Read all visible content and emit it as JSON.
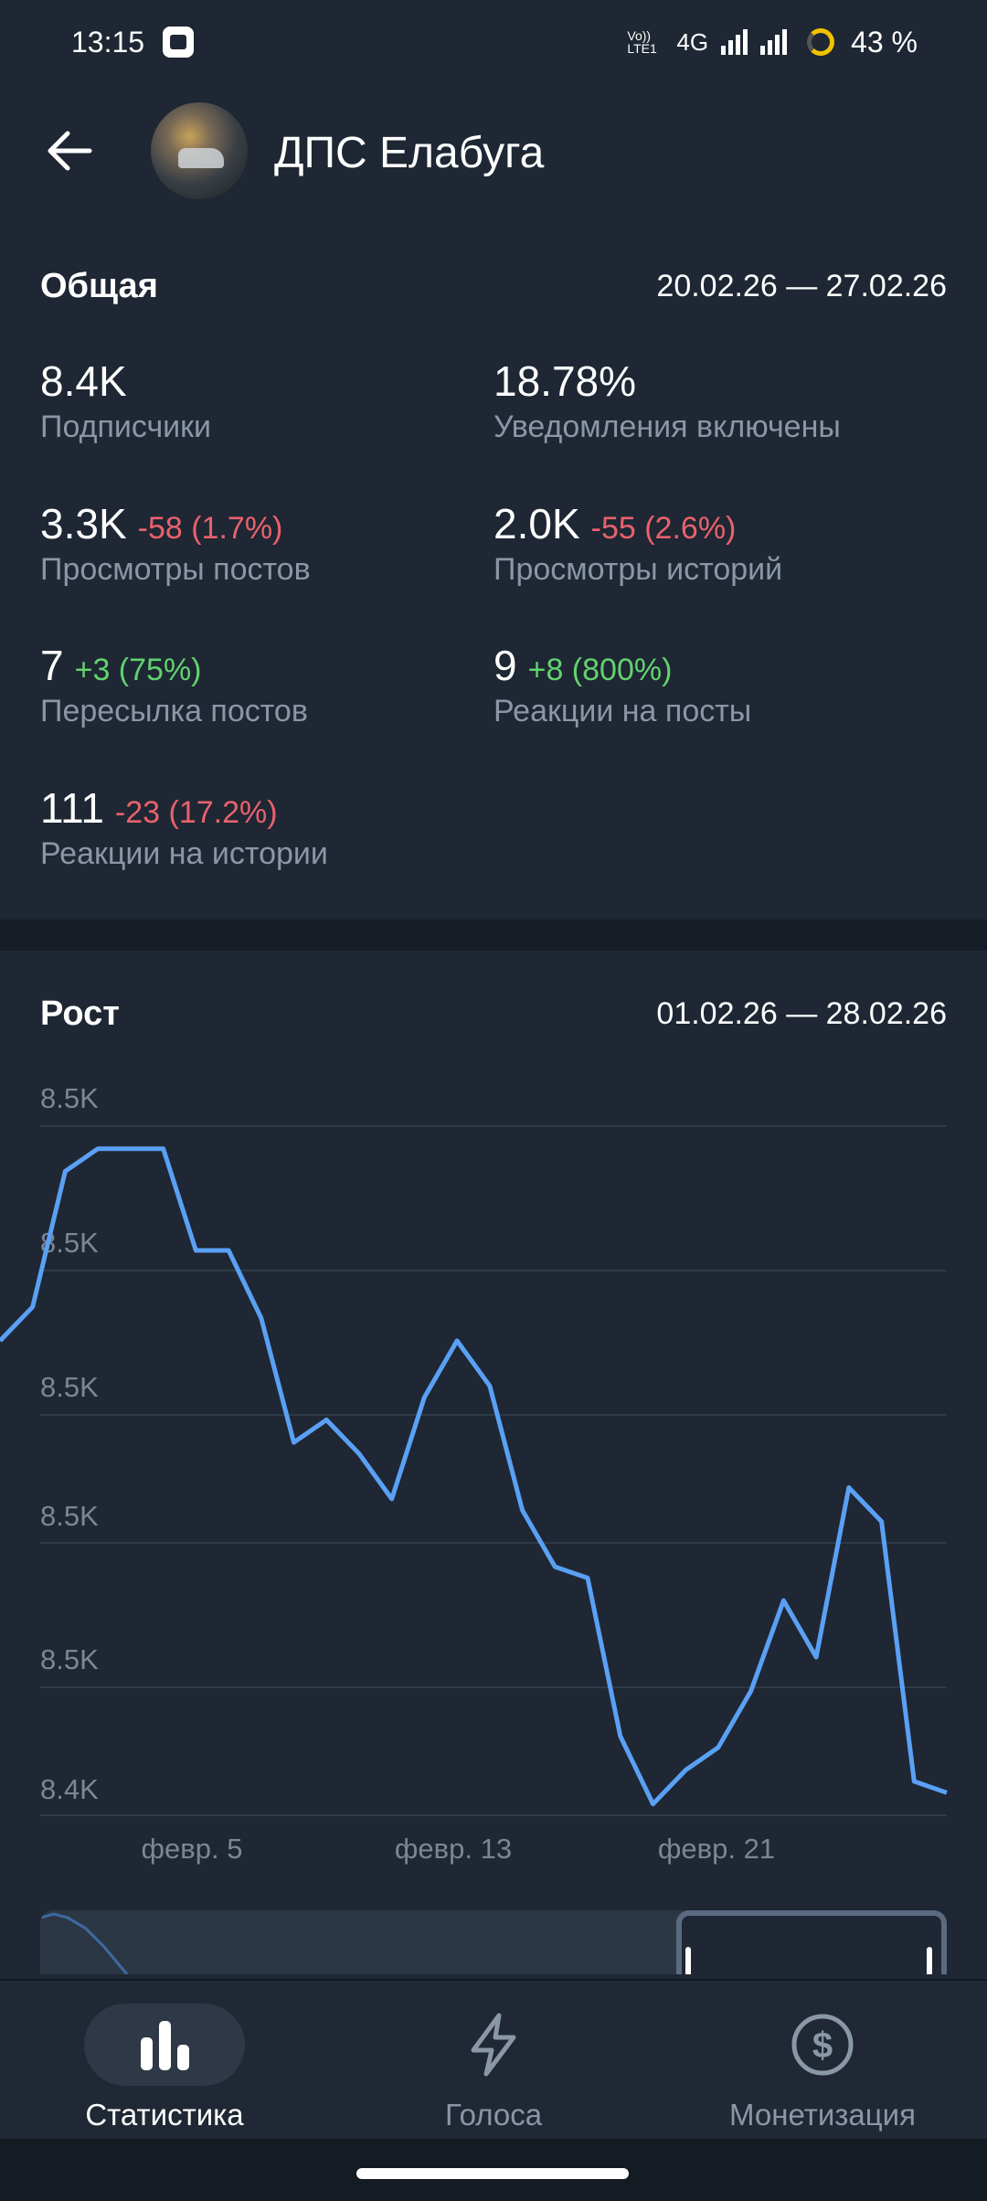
{
  "status_bar": {
    "time": "13:15",
    "network": "4G",
    "volte": "Vo)) LTE1",
    "battery": "43 %"
  },
  "header": {
    "title": "ДПС Елабуга"
  },
  "overview": {
    "title": "Общая",
    "date_range": "20.02.26 — 27.02.26",
    "stats": [
      {
        "value": "8.4K",
        "delta": "",
        "label": "Подписчики"
      },
      {
        "value": "18.78%",
        "delta": "",
        "label": "Уведомления включены"
      },
      {
        "value": "3.3K",
        "delta": "-58 (1.7%)",
        "label": "Просмотры постов"
      },
      {
        "value": "2.0K",
        "delta": "-55 (2.6%)",
        "label": "Просмотры историй"
      },
      {
        "value": "7",
        "delta": "+3 (75%)",
        "label": "Пересылка постов"
      },
      {
        "value": "9",
        "delta": "+8 (800%)",
        "label": "Реакции на посты"
      },
      {
        "value": "111",
        "delta": "-23 (17.2%)",
        "label": "Реакции на истории"
      }
    ]
  },
  "growth": {
    "title": "Рост",
    "date_range": "01.02.26 — 28.02.26"
  },
  "colors": {
    "line": "#5aa0f5",
    "negative": "#e8626d",
    "positive": "#62d26f"
  },
  "chart_data": {
    "type": "line",
    "y_tick_labels": [
      "8.5K",
      "8.5K",
      "8.5K",
      "8.5K",
      "8.5K",
      "8.4K"
    ],
    "x_tick_labels": [
      "февр. 5",
      "февр. 13",
      "февр. 21"
    ],
    "x": [
      1,
      2,
      3,
      4,
      5,
      6,
      7,
      8,
      9,
      10,
      11,
      12,
      13,
      14,
      15,
      16,
      17,
      18,
      19,
      20,
      21,
      22,
      23,
      24,
      25,
      26,
      27,
      28,
      29,
      30
    ],
    "series": [
      {
        "values": [
          8471,
          8474,
          8486,
          8488,
          8488,
          8488,
          8479,
          8479,
          8473,
          8462,
          8464,
          8461,
          8457,
          8466,
          8471,
          8467,
          8456,
          8451,
          8450,
          8436,
          8430,
          8433,
          8435,
          8440,
          8448,
          8443,
          8458,
          8455,
          8432,
          8431
        ]
      }
    ],
    "ylim": [
      8429,
      8490
    ],
    "grid": true
  },
  "bottom_nav": {
    "tabs": [
      {
        "label": "Статистика",
        "icon": "bar-chart-icon",
        "active": true
      },
      {
        "label": "Голоса",
        "icon": "lightning-icon",
        "active": false
      },
      {
        "label": "Монетизация",
        "icon": "dollar-icon",
        "active": false
      }
    ]
  }
}
